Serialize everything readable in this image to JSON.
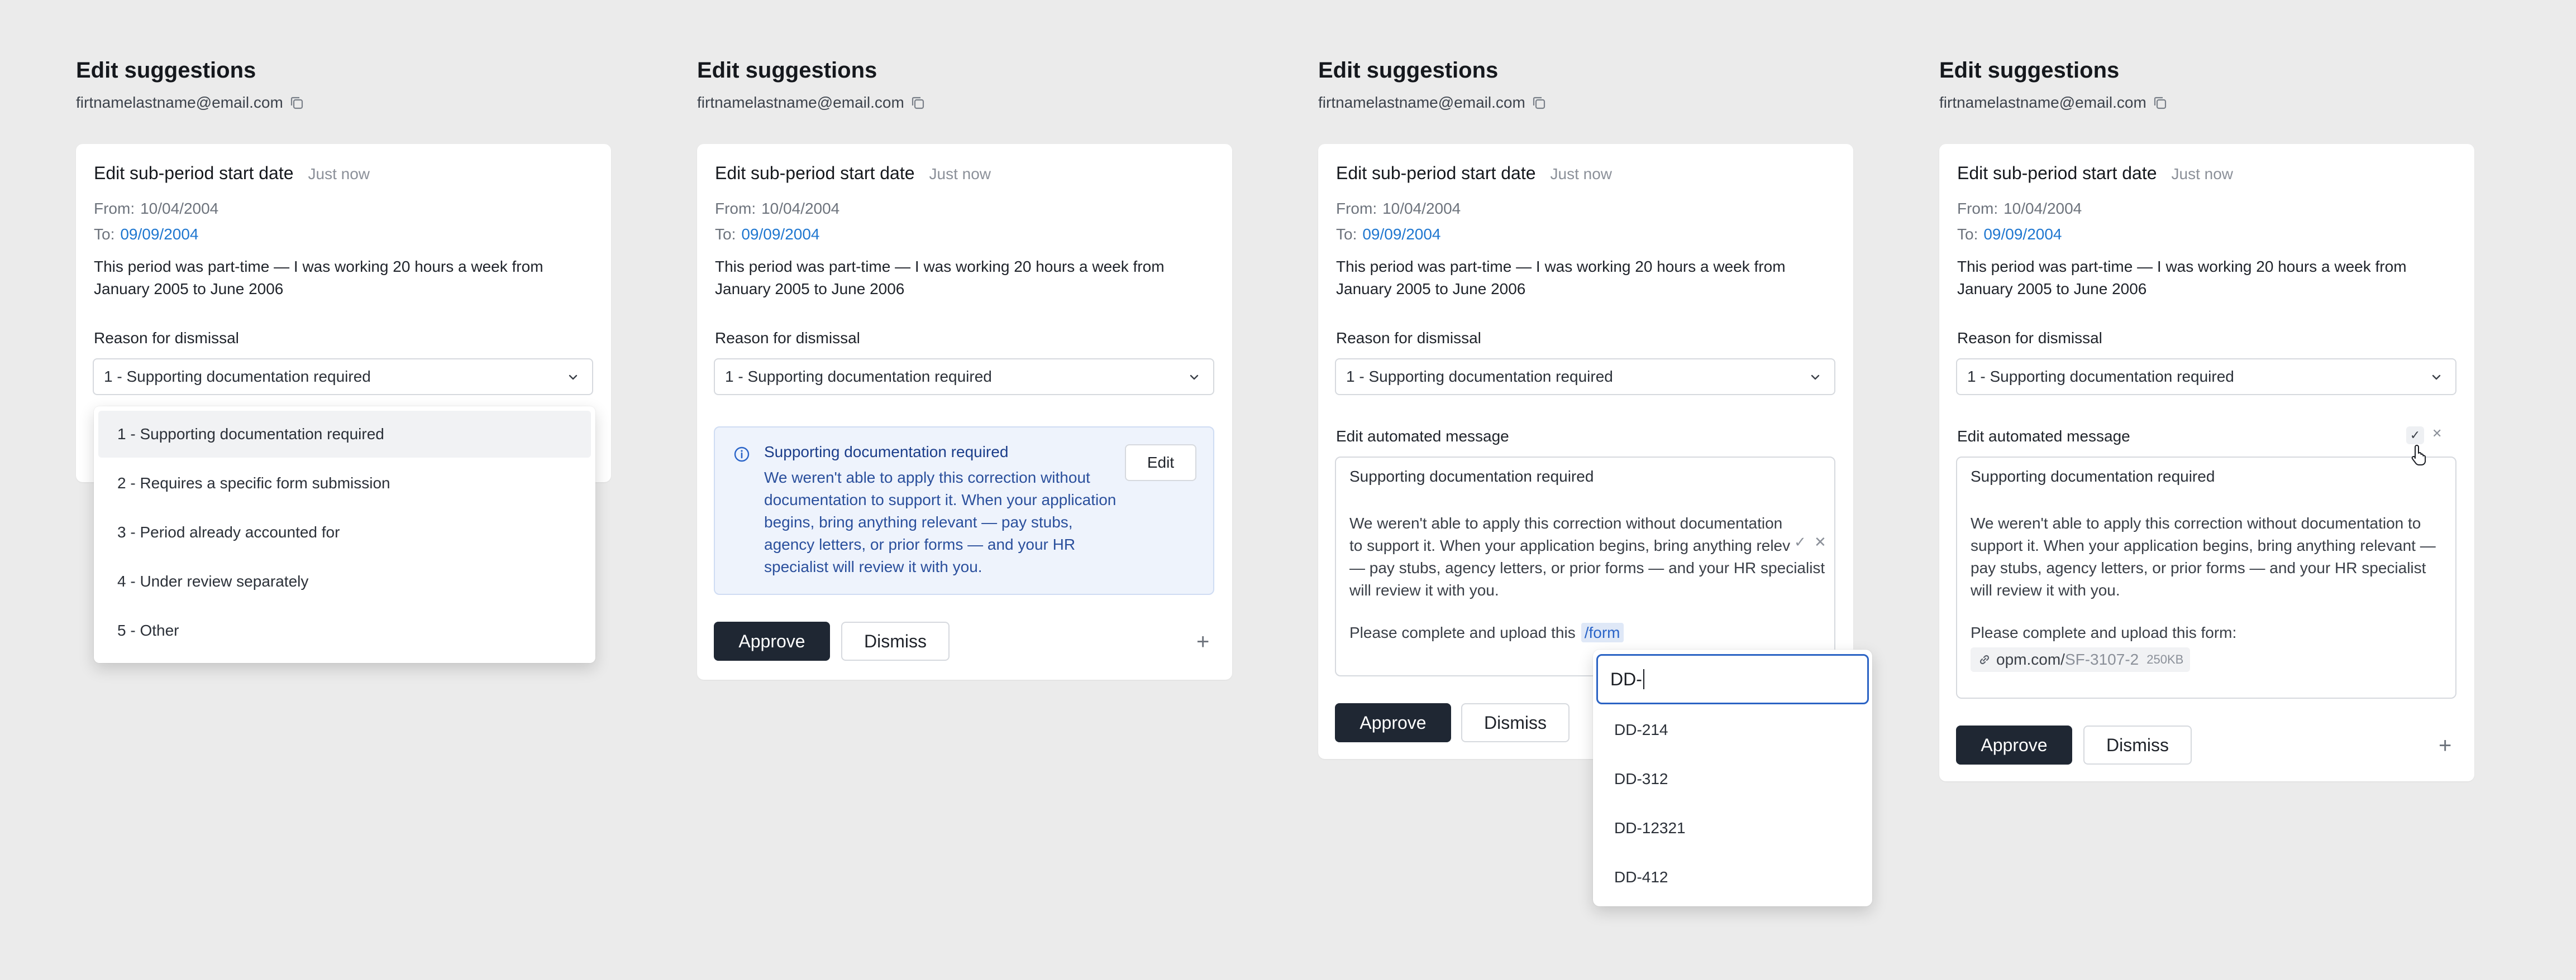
{
  "panels": [
    {
      "title": "Edit suggestions",
      "email": "firtnamelastname@email.com",
      "card": {
        "title": "Edit sub-period start date",
        "time": "Just now",
        "from_label": "From:",
        "from_value": "10/04/2004",
        "to_label": "To:",
        "to_value": "09/09/2004",
        "description": "This period was part-time — I was working 20 hours a week from January 2005 to June 2006",
        "reason_label": "Reason for dismissal",
        "reason_value": "1 - Supporting documentation required"
      },
      "dropdown": {
        "options": [
          "1 - Supporting documentation required",
          "2 - Requires a specific form submission",
          "3 - Period already accounted for",
          "4 - Under review separately",
          "5 - Other"
        ],
        "active_index": 0
      }
    },
    {
      "title": "Edit suggestions",
      "email": "firtnamelastname@email.com",
      "card": {
        "title": "Edit sub-period start date",
        "time": "Just now",
        "from_label": "From:",
        "from_value": "10/04/2004",
        "to_label": "To:",
        "to_value": "09/09/2004",
        "description": "This period was part-time — I was working 20 hours a week from January 2005 to June 2006",
        "reason_label": "Reason for dismissal",
        "reason_value": "1 - Supporting documentation required"
      },
      "info": {
        "title": "Supporting documentation required",
        "body": "We weren't able to apply this correction without documentation to support it. When your application begins, bring anything relevant — pay stubs, agency letters, or prior forms — and your HR specialist will review it with you.",
        "edit_label": "Edit"
      },
      "approve_label": "Approve",
      "dismiss_label": "Dismiss"
    },
    {
      "title": "Edit suggestions",
      "email": "firtnamelastname@email.com",
      "card": {
        "title": "Edit sub-period start date",
        "time": "Just now",
        "from_label": "From:",
        "from_value": "10/04/2004",
        "to_label": "To:",
        "to_value": "09/09/2004",
        "description": "This period was part-time — I was working 20 hours a week from January 2005 to June 2006",
        "reason_label": "Reason for dismissal",
        "reason_value": "1 - Supporting documentation required"
      },
      "message_label": "Edit automated message",
      "editor": {
        "title": "Supporting documentation required",
        "body": "We weren't able to apply this correction without documentation to support it. When your application begins, bring anything relev",
        "body_rest": "— pay stubs, agency letters, or prior forms — and your HR specialist will review it with you.",
        "upload_text": "Please complete and upload this",
        "slash_command": "/form"
      },
      "form_picker": {
        "query": "DD-",
        "options": [
          "DD-214",
          "DD-312",
          "DD-12321",
          "DD-412"
        ]
      },
      "approve_label": "Approve",
      "dismiss_label": "Dismiss"
    },
    {
      "title": "Edit suggestions",
      "email": "firtnamelastname@email.com",
      "card": {
        "title": "Edit sub-period start date",
        "time": "Just now",
        "from_label": "From:",
        "from_value": "10/04/2004",
        "to_label": "To:",
        "to_value": "09/09/2004",
        "description": "This period was part-time — I was working 20 hours a week from January 2005 to June 2006",
        "reason_label": "Reason for dismissal",
        "reason_value": "1 - Supporting documentation required"
      },
      "message_label": "Edit automated message",
      "editor": {
        "title": "Supporting documentation required",
        "body": "We weren't able to apply this correction without documentation to support it. When your application begins, bring anything relevant — pay stubs, agency letters, or prior forms — and your HR specialist will review it with you.",
        "upload_text": "Please complete and upload this form:",
        "link_host": "opm.com/",
        "link_path": "SF-3107-2",
        "link_size": "250KB"
      },
      "approve_label": "Approve",
      "dismiss_label": "Dismiss"
    }
  ],
  "colors": {
    "background": "#ebebeb",
    "card": "#ffffff",
    "primary_button": "#1f2733",
    "link_blue": "#1f77d0",
    "info_bg": "#eef3fc",
    "info_text": "#2a4f9c",
    "focus_border": "#2b63c4"
  },
  "icons": [
    "copy-icon",
    "chevron-down-icon",
    "info-icon",
    "plus-icon",
    "check-icon",
    "close-icon",
    "link-icon",
    "pointer-cursor-icon"
  ]
}
